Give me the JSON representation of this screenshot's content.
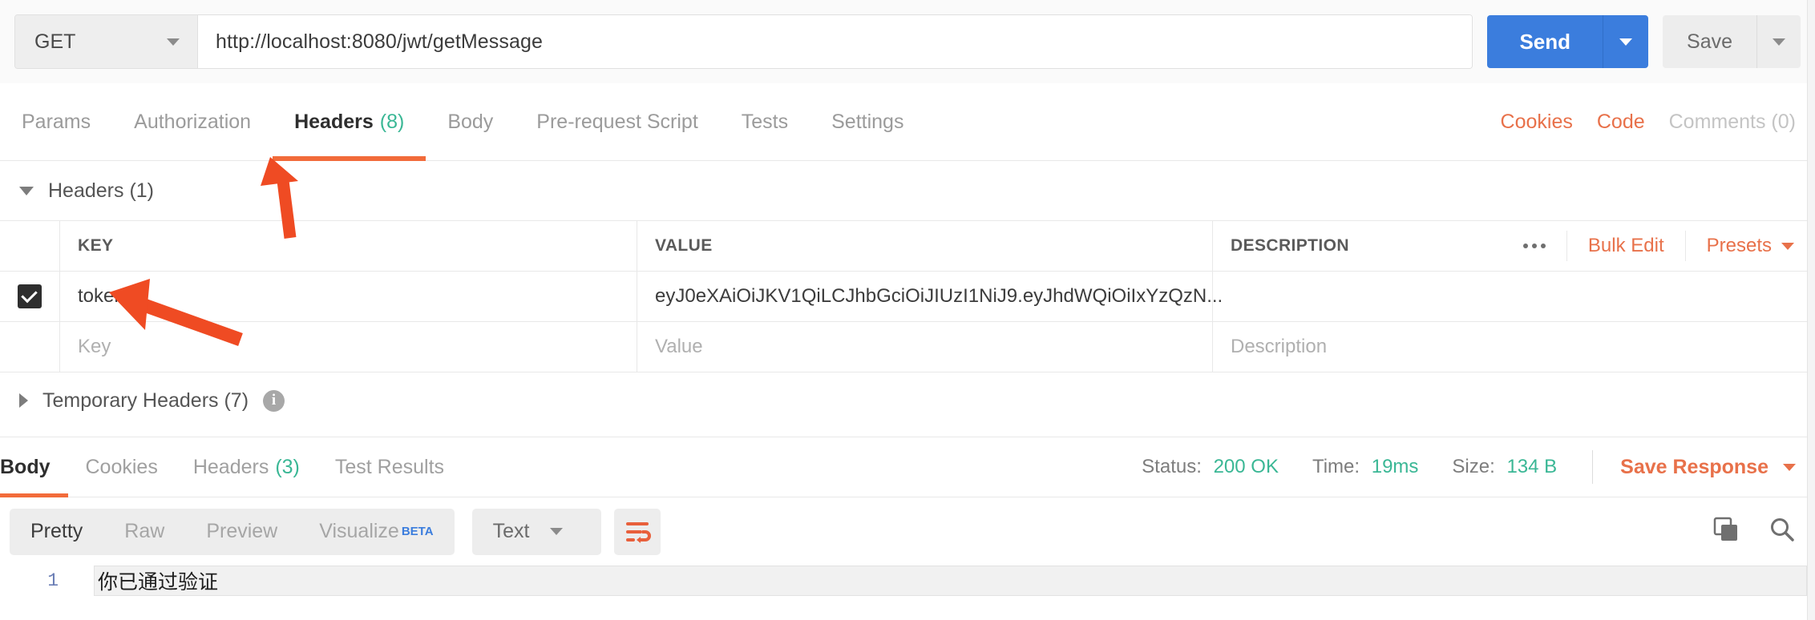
{
  "request": {
    "method": "GET",
    "url": "http://localhost:8080/jwt/getMessage",
    "send_label": "Send",
    "save_label": "Save",
    "tabs": [
      {
        "label": "Params",
        "count": "",
        "active": false
      },
      {
        "label": "Authorization",
        "count": "",
        "active": false
      },
      {
        "label": "Headers",
        "count": "(8)",
        "active": true
      },
      {
        "label": "Body",
        "count": "",
        "active": false
      },
      {
        "label": "Pre-request Script",
        "count": "",
        "active": false
      },
      {
        "label": "Tests",
        "count": "",
        "active": false
      },
      {
        "label": "Settings",
        "count": "",
        "active": false
      }
    ],
    "right_links": [
      {
        "label": "Cookies",
        "style": "orange"
      },
      {
        "label": "Code",
        "style": "orange"
      },
      {
        "label": "Comments (0)",
        "style": "grey"
      }
    ]
  },
  "headers_section": {
    "title": "Headers (1)",
    "columns": {
      "key": "KEY",
      "value": "VALUE",
      "description": "DESCRIPTION"
    },
    "tools": {
      "bulk_edit": "Bulk Edit",
      "presets": "Presets"
    },
    "rows": [
      {
        "checked": true,
        "key": "token",
        "value": "eyJ0eXAiOiJKV1QiLCJhbGciOiJIUzI1NiJ9.eyJhdWQiOiIxYzQzN...",
        "description": ""
      }
    ],
    "placeholders": {
      "key": "Key",
      "value": "Value",
      "description": "Description"
    }
  },
  "temporary_headers": {
    "title": "Temporary Headers (7)"
  },
  "response": {
    "tabs": [
      {
        "label": "Body",
        "count": "",
        "active": true
      },
      {
        "label": "Cookies",
        "count": "",
        "active": false
      },
      {
        "label": "Headers",
        "count": "(3)",
        "active": false
      },
      {
        "label": "Test Results",
        "count": "",
        "active": false
      }
    ],
    "status_label": "Status:",
    "status_value": "200 OK",
    "time_label": "Time:",
    "time_value": "19ms",
    "size_label": "Size:",
    "size_value": "134 B",
    "save_response": "Save Response",
    "viewer_modes": [
      {
        "label": "Pretty",
        "active": true
      },
      {
        "label": "Raw",
        "active": false
      },
      {
        "label": "Preview",
        "active": false
      },
      {
        "label": "Visualize",
        "active": false,
        "badge": "BETA"
      }
    ],
    "format": "Text",
    "body_lines": [
      {
        "number": "1",
        "text": "你已通过验证"
      }
    ]
  },
  "colors": {
    "accent_orange": "#f26b3a",
    "link_orange": "#e8714a",
    "send_blue": "#3b7ddd",
    "success_green": "#3ab795",
    "annotation_red": "#ef4b23"
  }
}
